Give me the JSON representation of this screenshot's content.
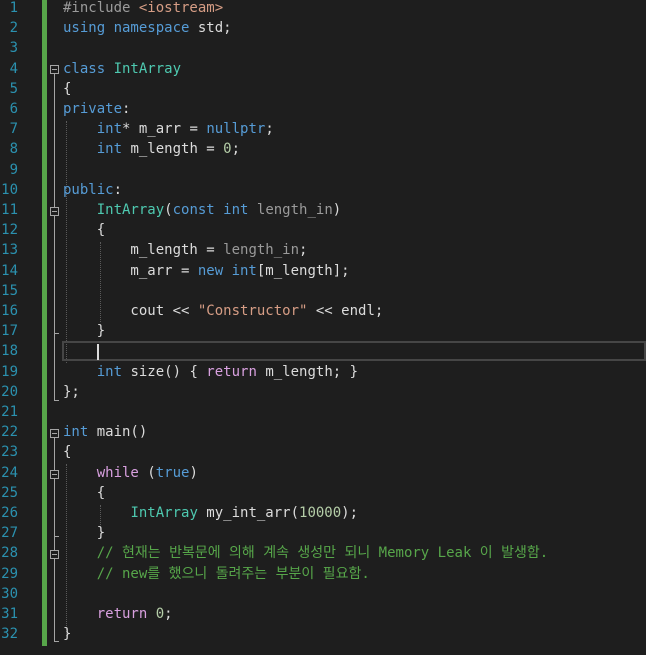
{
  "editor": {
    "lines": [
      {
        "n": "1",
        "tokens": [
          [
            "pre",
            "#include "
          ],
          [
            "str",
            "<iostream>"
          ]
        ]
      },
      {
        "n": "2",
        "tokens": [
          [
            "kw",
            "using namespace "
          ],
          [
            "var",
            "std;"
          ]
        ]
      },
      {
        "n": "3",
        "tokens": []
      },
      {
        "n": "4",
        "tokens": [
          [
            "kw",
            "class "
          ],
          [
            "type",
            "IntArray"
          ]
        ]
      },
      {
        "n": "5",
        "tokens": [
          [
            "var",
            "{"
          ]
        ]
      },
      {
        "n": "6",
        "tokens": [
          [
            "kw",
            "private"
          ],
          [
            "var",
            ":"
          ]
        ]
      },
      {
        "n": "7",
        "tokens": [
          [
            "var",
            "    "
          ],
          [
            "kw",
            "int"
          ],
          [
            "var",
            "* m_arr = "
          ],
          [
            "kw",
            "nullptr"
          ],
          [
            "var",
            ";"
          ]
        ]
      },
      {
        "n": "8",
        "tokens": [
          [
            "var",
            "    "
          ],
          [
            "kw",
            "int "
          ],
          [
            "var",
            "m_length = "
          ],
          [
            "num",
            "0"
          ],
          [
            "var",
            ";"
          ]
        ]
      },
      {
        "n": "9",
        "tokens": []
      },
      {
        "n": "10",
        "tokens": [
          [
            "kw",
            "public"
          ],
          [
            "var",
            ":"
          ]
        ]
      },
      {
        "n": "11",
        "tokens": [
          [
            "var",
            "    "
          ],
          [
            "type",
            "IntArray"
          ],
          [
            "var",
            "("
          ],
          [
            "kw",
            "const int "
          ],
          [
            "param",
            "length_in"
          ],
          [
            "var",
            ")"
          ]
        ]
      },
      {
        "n": "12",
        "tokens": [
          [
            "var",
            "    {"
          ]
        ]
      },
      {
        "n": "13",
        "tokens": [
          [
            "var",
            "        m_length = "
          ],
          [
            "param",
            "length_in"
          ],
          [
            "var",
            ";"
          ]
        ]
      },
      {
        "n": "14",
        "tokens": [
          [
            "var",
            "        m_arr = "
          ],
          [
            "kw",
            "new int"
          ],
          [
            "var",
            "[m_length];"
          ]
        ]
      },
      {
        "n": "15",
        "tokens": []
      },
      {
        "n": "16",
        "tokens": [
          [
            "var",
            "        cout << "
          ],
          [
            "str",
            "\"Constructor\""
          ],
          [
            "var",
            " << endl;"
          ]
        ]
      },
      {
        "n": "17",
        "tokens": [
          [
            "var",
            "    }"
          ]
        ]
      },
      {
        "n": "18",
        "tokens": []
      },
      {
        "n": "19",
        "tokens": [
          [
            "var",
            "    "
          ],
          [
            "kw",
            "int "
          ],
          [
            "var",
            "size() { "
          ],
          [
            "ctrl",
            "return "
          ],
          [
            "var",
            "m_length; }"
          ]
        ]
      },
      {
        "n": "20",
        "tokens": [
          [
            "var",
            "};"
          ]
        ]
      },
      {
        "n": "21",
        "tokens": []
      },
      {
        "n": "22",
        "tokens": [
          [
            "kw",
            "int "
          ],
          [
            "var",
            "main()"
          ]
        ]
      },
      {
        "n": "23",
        "tokens": [
          [
            "var",
            "{"
          ]
        ]
      },
      {
        "n": "24",
        "tokens": [
          [
            "var",
            "    "
          ],
          [
            "ctrl",
            "while "
          ],
          [
            "var",
            "("
          ],
          [
            "kw",
            "true"
          ],
          [
            "var",
            ")"
          ]
        ]
      },
      {
        "n": "25",
        "tokens": [
          [
            "var",
            "    {"
          ]
        ]
      },
      {
        "n": "26",
        "tokens": [
          [
            "var",
            "        "
          ],
          [
            "type",
            "IntArray "
          ],
          [
            "var",
            "my_int_arr("
          ],
          [
            "num",
            "10000"
          ],
          [
            "var",
            ");"
          ]
        ]
      },
      {
        "n": "27",
        "tokens": [
          [
            "var",
            "    }"
          ]
        ]
      },
      {
        "n": "28",
        "tokens": [
          [
            "var",
            "    "
          ],
          [
            "cmt",
            "// 현재는 반복문에 의해 계속 생성만 되니 Memory Leak 이 발생함."
          ]
        ]
      },
      {
        "n": "29",
        "tokens": [
          [
            "var",
            "    "
          ],
          [
            "cmt",
            "// new를 했으니 돌려주는 부분이 필요함."
          ]
        ]
      },
      {
        "n": "30",
        "tokens": []
      },
      {
        "n": "31",
        "tokens": [
          [
            "var",
            "    "
          ],
          [
            "ctrl",
            "return "
          ],
          [
            "num",
            "0"
          ],
          [
            "var",
            ";"
          ]
        ]
      },
      {
        "n": "32",
        "tokens": [
          [
            "var",
            "}"
          ]
        ]
      }
    ],
    "current_line": "18",
    "colors": {
      "background": "#1e1e1e",
      "line_number": "#2b91af",
      "keyword": "#569cd6",
      "control": "#d8a0df",
      "type": "#4ec9b0",
      "string": "#d69d85",
      "comment": "#57a64a",
      "change_bar": "#57a64a"
    },
    "icons": [
      "collapse-icon"
    ]
  }
}
